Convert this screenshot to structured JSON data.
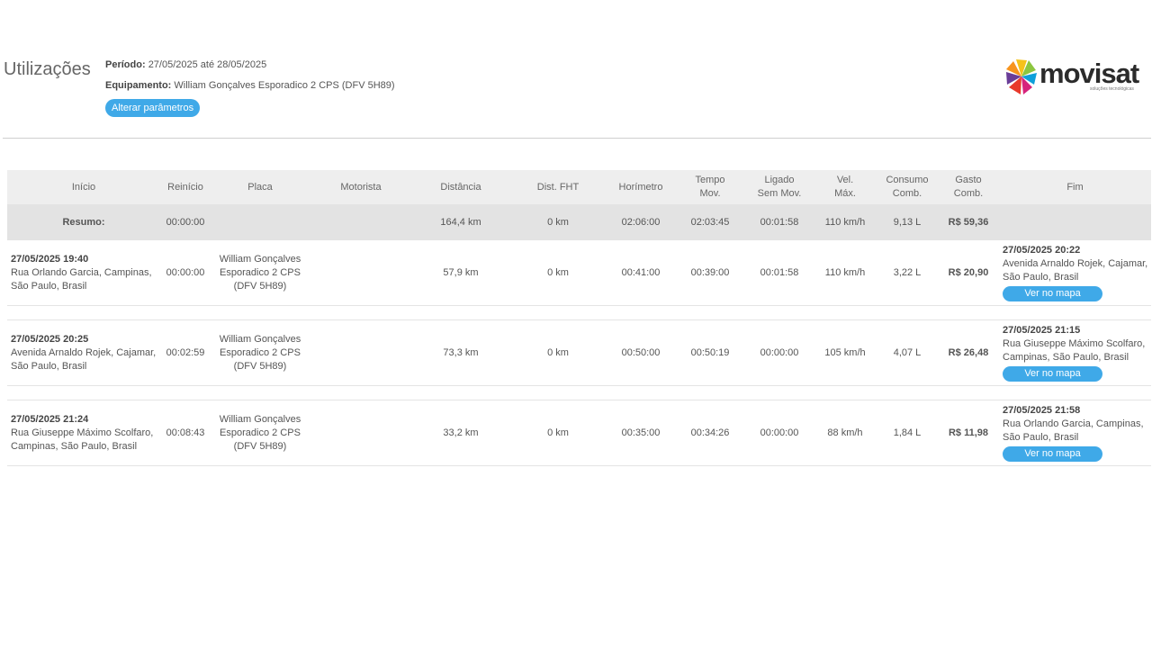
{
  "header": {
    "title": "Utilizações",
    "periodo_label": "Período:",
    "periodo_value": "27/05/2025 até 28/05/2025",
    "equipamento_label": "Equipamento:",
    "equipamento_value": "William Gonçalves Esporadico 2 CPS (DFV 5H89)",
    "alterar_button": "Alterar parâmetros"
  },
  "logo": {
    "brand": "movisat",
    "tagline": "soluções tecnológicas",
    "colors": [
      "#f4c21b",
      "#8cc63f",
      "#0e9fda",
      "#d6247c",
      "#e8392b",
      "#6a3d98"
    ]
  },
  "table": {
    "headers": {
      "inicio": "Início",
      "reinicio": "Reinício",
      "placa": "Placa",
      "motorista": "Motorista",
      "distancia": "Distância",
      "dist_fht": "Dist. FHT",
      "horimetro": "Horímetro",
      "tempo_mov_1": "Tempo",
      "tempo_mov_2": "Mov.",
      "ligado_1": "Ligado",
      "ligado_2": "Sem Mov.",
      "vel_1": "Vel.",
      "vel_2": "Máx.",
      "consumo_1": "Consumo",
      "consumo_2": "Comb.",
      "gasto_1": "Gasto",
      "gasto_2": "Comb.",
      "fim": "Fim"
    },
    "summary": {
      "label": "Resumo:",
      "reinicio": "00:00:00",
      "distancia": "164,4 km",
      "dist_fht": "0 km",
      "horimetro": "02:06:00",
      "tempo_mov": "02:03:45",
      "ligado": "00:01:58",
      "vel": "110 km/h",
      "consumo": "9,13 L",
      "gasto": "R$ 59,36"
    },
    "rows": [
      {
        "inicio_dt": "27/05/2025 19:40",
        "inicio_addr": "Rua Orlando Garcia, Campinas, São Paulo, Brasil",
        "reinicio": "00:00:00",
        "placa": "William Gonçalves Esporadico 2 CPS (DFV 5H89)",
        "distancia": "57,9 km",
        "dist_fht": "0 km",
        "horimetro": "00:41:00",
        "tempo_mov": "00:39:00",
        "ligado": "00:01:58",
        "vel": "110 km/h",
        "consumo": "3,22 L",
        "gasto": "R$ 20,90",
        "fim_dt": "27/05/2025 20:22",
        "fim_addr": "Avenida Arnaldo Rojek, Cajamar, São Paulo, Brasil",
        "map_button": "Ver no mapa"
      },
      {
        "inicio_dt": "27/05/2025 20:25",
        "inicio_addr": "Avenida Arnaldo Rojek, Cajamar, São Paulo, Brasil",
        "reinicio": "00:02:59",
        "placa": "William Gonçalves Esporadico 2 CPS (DFV 5H89)",
        "distancia": "73,3 km",
        "dist_fht": "0 km",
        "horimetro": "00:50:00",
        "tempo_mov": "00:50:19",
        "ligado": "00:00:00",
        "vel": "105 km/h",
        "consumo": "4,07 L",
        "gasto": "R$ 26,48",
        "fim_dt": "27/05/2025 21:15",
        "fim_addr": "Rua Giuseppe Máximo Scolfaro, Campinas, São Paulo, Brasil",
        "map_button": "Ver no mapa"
      },
      {
        "inicio_dt": "27/05/2025 21:24",
        "inicio_addr": "Rua Giuseppe Máximo Scolfaro, Campinas, São Paulo, Brasil",
        "reinicio": "00:08:43",
        "placa": "William Gonçalves Esporadico 2 CPS (DFV 5H89)",
        "distancia": "33,2 km",
        "dist_fht": "0 km",
        "horimetro": "00:35:00",
        "tempo_mov": "00:34:26",
        "ligado": "00:00:00",
        "vel": "88 km/h",
        "consumo": "1,84 L",
        "gasto": "R$ 11,98",
        "fim_dt": "27/05/2025 21:58",
        "fim_addr": "Rua Orlando Garcia, Campinas, São Paulo, Brasil",
        "map_button": "Ver no mapa"
      }
    ]
  }
}
